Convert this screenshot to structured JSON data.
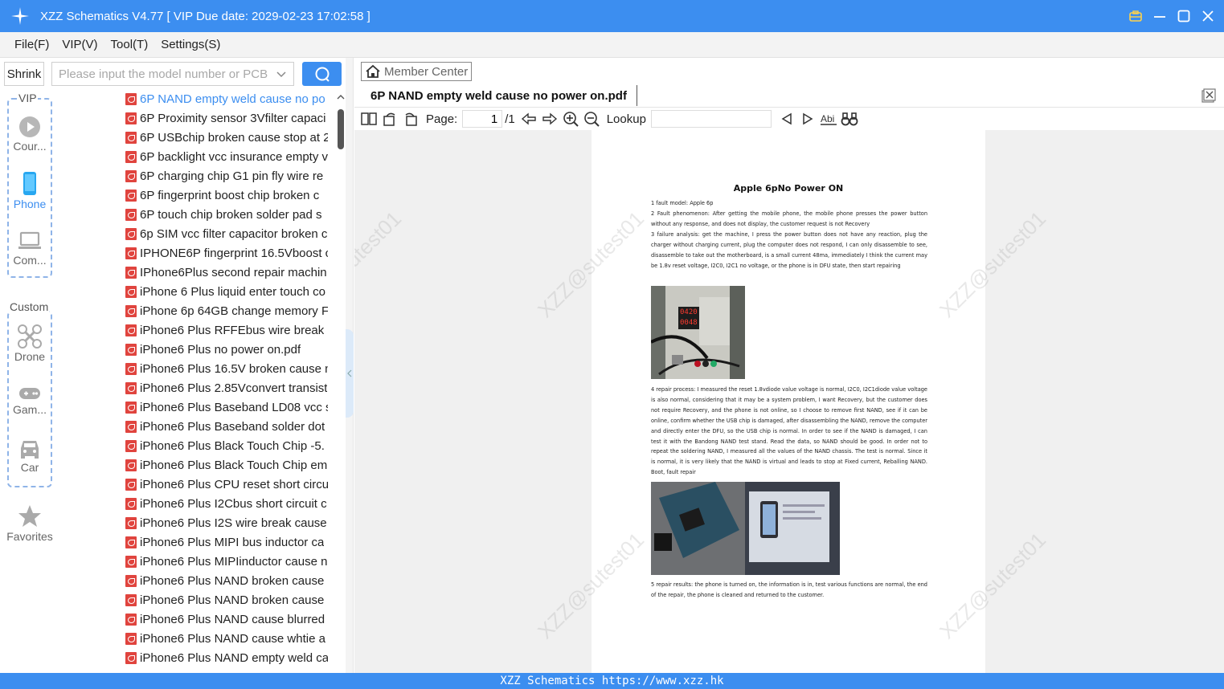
{
  "window": {
    "title": "XZZ Schematics V4.77 [ VIP Due date: 2029-02-23 17:02:58 ]"
  },
  "menu": [
    "File(F)",
    "VIP(V)",
    "Tool(T)",
    "Settings(S)"
  ],
  "search": {
    "shrink_label": "Shrink",
    "placeholder": "Please input the model number or PCB"
  },
  "categories": {
    "vip_label": "VIP",
    "custom_label": "Custom",
    "course": "Cour...",
    "phone": "Phone",
    "computer": "Com...",
    "drone": "Drone",
    "game": "Gam...",
    "car": "Car",
    "favorites": "Favorites"
  },
  "files": [
    "6P NAND empty weld cause no po",
    "6P Proximity sensor 3Vfilter capaci",
    "6P USBchip broken cause stop at 2",
    "6P backlight vcc insurance empty v",
    "6P charging chip G1 pin fly wire re",
    "6P fingerprint boost chip broken c",
    "6P touch chip broken solder pad s",
    "6p SIM vcc filter capacitor broken c",
    "IPHONE6P fingerprint 16.5Vboost c",
    "IPhone6Plus second repair machin",
    "iPhone 6 Plus liquid enter touch co",
    "iPhone 6p 64GB change memory F",
    "iPhone6 Plus  RFFEbus wire break",
    "iPhone6 Plus  no power on.pdf",
    "iPhone6 Plus 16.5V broken cause n",
    "iPhone6 Plus 2.85Vconvert transist",
    "iPhone6 Plus Baseband LD08 vcc s",
    "iPhone6 Plus Baseband solder dot",
    "iPhone6 Plus Black Touch Chip -5.",
    "iPhone6 Plus Black Touch Chip em",
    "iPhone6 Plus CPU reset short circu",
    "iPhone6 Plus I2Cbus short circuit c",
    "iPhone6 Plus I2S wire break  cause",
    "iPhone6 Plus MIPI bus inductor ca",
    "iPhone6 Plus MIPIinductor cause n",
    "iPhone6 Plus NAND broken cause",
    "iPhone6 Plus NAND broken cause",
    "iPhone6 Plus NAND cause blurred",
    "iPhone6 Plus NAND cause whtie a",
    "iPhone6 Plus NAND empty weld ca"
  ],
  "viewer": {
    "member_center": "Member Center",
    "tab_title": "6P NAND empty weld cause no power on.pdf",
    "page_label": "Page:",
    "page_current": "1",
    "page_total": "/1",
    "lookup_label": "Lookup",
    "lookup_value": ""
  },
  "document": {
    "title": "Apple 6pNo Power ON",
    "p1": "1 fault model: Apple 6p",
    "p2": "2 Fault phenomenon: After getting the mobile phone, the mobile phone presses the power button without any response, and does not display, the customer request is not Recovery",
    "p3": "3 failure analysis: get the machine, I press the power button does not have any reaction, plug the charger without charging current, plug the computer does not respond, I can only disassemble to see, disassemble to take out the motherboard, is a small current 48ma, immediately I think the current may be 1.8v reset voltage, I2C0, I2C1 no voltage, or the phone is in DFU state, then start repairing",
    "p4": "4 repair process: I measured the reset 1.8vdiode value voltage is normal, I2C0, I2C1diode value voltage is also normal, considering that it may be a system problem, I want Recovery, but the customer does not require Recovery, and the phone is not online, so I choose to remove first NAND, see if it can be online, confirm whether the USB chip is damaged, after disassembling the NAND, remove the computer and directly enter the DFU, so the USB chip is normal. In order to see if the NAND is damaged, I can test it with the Bandong NAND test stand. Read the data, so NAND should be good. In order not to repeat the soldering NAND, I measured all the values of the NAND chassis. The test is normal. Since it is normal, it is very likely that the NAND is virtual and leads to stop at Fixed current, Reballing NAND. Boot, fault repair",
    "p5": "5 repair results: the phone is turned on, the information is in, test various functions are normal, the end of the repair, the phone is cleaned and returned to the customer.",
    "photo1_display_top": "0420",
    "photo1_display_bottom": "0048",
    "watermark": "XZZ@sutest01"
  },
  "status_bar": "XZZ Schematics https://www.xzz.hk",
  "colors": {
    "accent": "#3c8ef0",
    "pdf_red": "#e0443e",
    "selected_text": "#3c8ef0"
  }
}
